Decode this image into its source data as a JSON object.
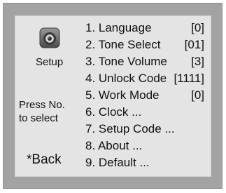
{
  "left_panel": {
    "icon": "gear-icon",
    "setup_label": "Setup",
    "instruction_line1": "Press No.",
    "instruction_line2": "to select",
    "back_label": "*Back"
  },
  "menu": {
    "items": [
      {
        "label": "1. Language",
        "value": "[0]"
      },
      {
        "label": "2. Tone Select",
        "value": "[01]"
      },
      {
        "label": "3. Tone Volume",
        "value": "[3]"
      },
      {
        "label": "4. Unlock Code",
        "value": "[1111]"
      },
      {
        "label": "5. Work Mode",
        "value": "[0]"
      },
      {
        "label": "6. Clock ...",
        "value": ""
      },
      {
        "label": "7. Setup Code ...",
        "value": ""
      },
      {
        "label": "8. About ...",
        "value": ""
      },
      {
        "label": "9. Default ...",
        "value": ""
      }
    ]
  },
  "colors": {
    "bezel": "#a3a3a3",
    "screen": "#e4e4e4",
    "text": "#111111"
  }
}
